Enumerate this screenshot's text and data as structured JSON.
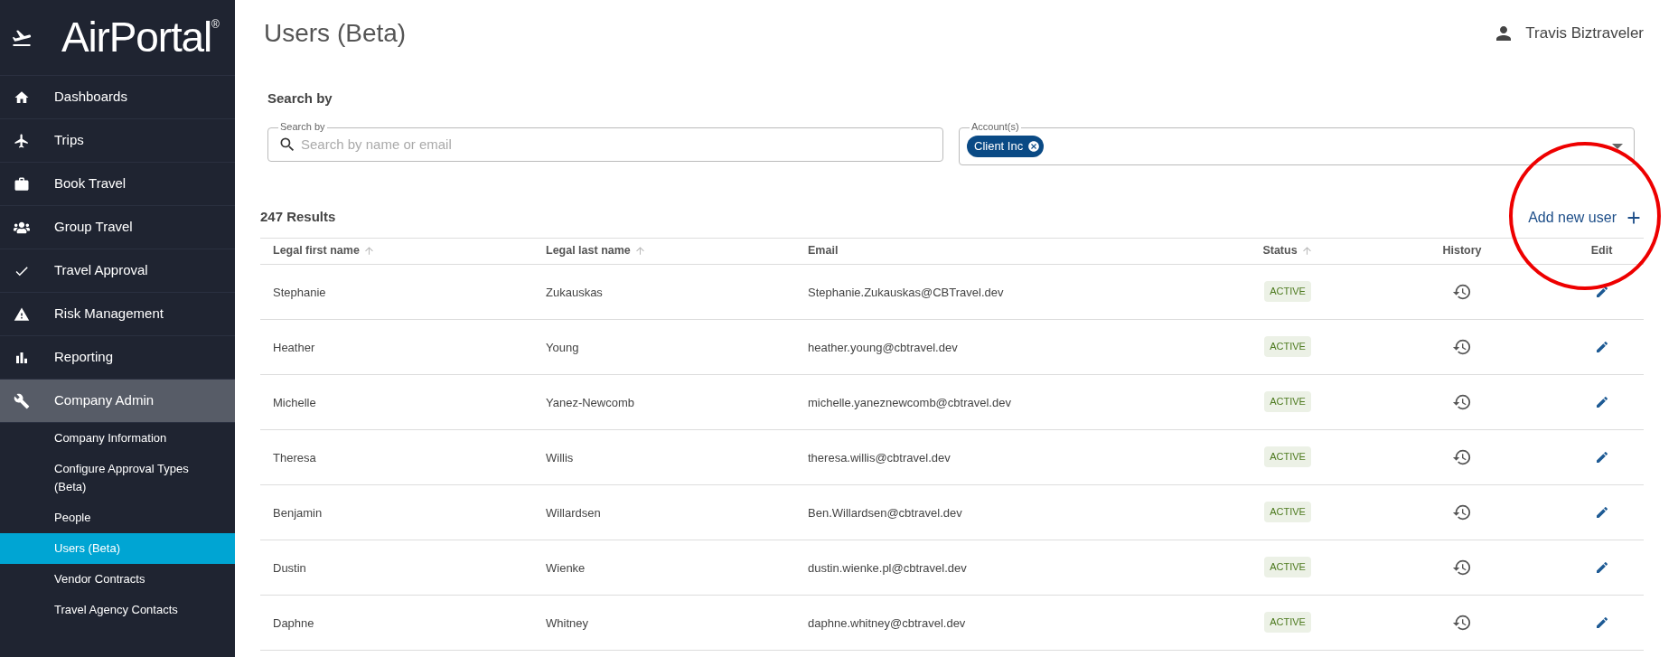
{
  "brand": {
    "name": "AirPortal",
    "mark": "®"
  },
  "sidebar": {
    "items": [
      {
        "label": "Dashboards",
        "selected": false
      },
      {
        "label": "Trips",
        "selected": false
      },
      {
        "label": "Book Travel",
        "selected": false
      },
      {
        "label": "Group Travel",
        "selected": false
      },
      {
        "label": "Travel Approval",
        "selected": false
      },
      {
        "label": "Risk Management",
        "selected": false
      },
      {
        "label": "Reporting",
        "selected": false
      },
      {
        "label": "Company Admin",
        "selected": true,
        "children": [
          {
            "label": "Company Information",
            "selected": false
          },
          {
            "label": "Configure Approval Types (Beta)",
            "selected": false
          },
          {
            "label": "People",
            "selected": false
          },
          {
            "label": "Users (Beta)",
            "selected": true
          },
          {
            "label": "Vendor Contracts",
            "selected": false
          },
          {
            "label": "Travel Agency Contacts",
            "selected": false
          }
        ]
      }
    ]
  },
  "page_title": "Users (Beta)",
  "user": {
    "name": "Travis Biztraveler"
  },
  "search": {
    "heading": "Search by",
    "field_label": "Search by",
    "placeholder": "Search by name or email",
    "accounts_label": "Account(s)",
    "accounts": [
      "Client Inc"
    ]
  },
  "results_count": "247 Results",
  "add_button": "Add new user",
  "table": {
    "columns": [
      {
        "label": "Legal first name",
        "sortable": true
      },
      {
        "label": "Legal last name",
        "sortable": true
      },
      {
        "label": "Email",
        "sortable": false
      },
      {
        "label": "Status",
        "sortable": true
      },
      {
        "label": "History",
        "sortable": false
      },
      {
        "label": "Edit",
        "sortable": false
      }
    ],
    "rows": [
      {
        "first": "Stephanie",
        "last": "Zukauskas",
        "email": "Stephanie.Zukauskas@CBTravel.dev",
        "status": "ACTIVE"
      },
      {
        "first": "Heather",
        "last": "Young",
        "email": "heather.young@cbtravel.dev",
        "status": "ACTIVE"
      },
      {
        "first": "Michelle",
        "last": "Yanez-Newcomb",
        "email": "michelle.yaneznewcomb@cbtravel.dev",
        "status": "ACTIVE"
      },
      {
        "first": "Theresa",
        "last": "Willis",
        "email": "theresa.willis@cbtravel.dev",
        "status": "ACTIVE"
      },
      {
        "first": "Benjamin",
        "last": "Willardsen",
        "email": "Ben.Willardsen@cbtravel.dev",
        "status": "ACTIVE"
      },
      {
        "first": "Dustin",
        "last": "Wienke",
        "email": "dustin.wienke.pl@cbtravel.dev",
        "status": "ACTIVE"
      },
      {
        "first": "Daphne",
        "last": "Whitney",
        "email": "daphne.whitney@cbtravel.dev",
        "status": "ACTIVE"
      }
    ]
  }
}
